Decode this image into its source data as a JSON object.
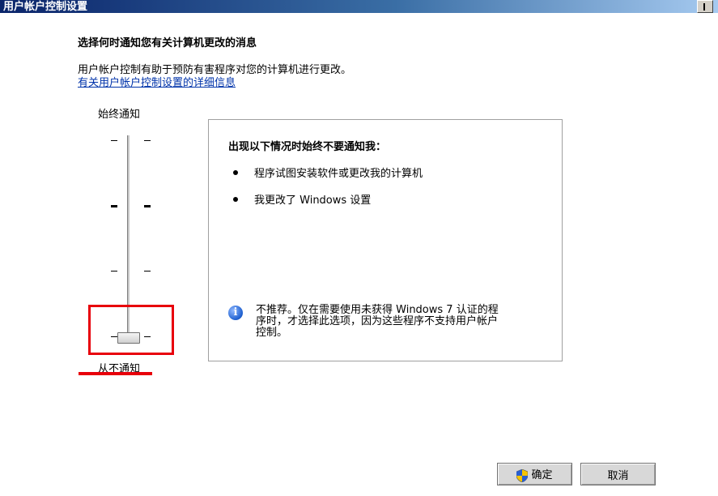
{
  "window": {
    "title": "用户帐户控制设置"
  },
  "heading": "选择何时通知您有关计算机更改的消息",
  "description": "用户帐户控制有助于预防有害程序对您的计算机进行更改。",
  "link": "有关用户帐户控制设置的详细信息",
  "slider": {
    "top_label": "始终通知",
    "bottom_label": "从不通知",
    "levels": 4,
    "selected_level": 1
  },
  "panel": {
    "title": "出现以下情况时始终不要通知我：",
    "bullets": [
      "程序试图安装软件或更改我的计算机",
      "我更改了 Windows 设置"
    ],
    "note_lines": [
      "不推荐。仅在需要使用未获得 Windows 7 认证的程",
      "序时，才选择此选项，因为这些程序不支持用户帐户",
      "控制。"
    ]
  },
  "buttons": {
    "ok": "确定",
    "cancel": "取消"
  },
  "annotation_color": "#e8000b"
}
